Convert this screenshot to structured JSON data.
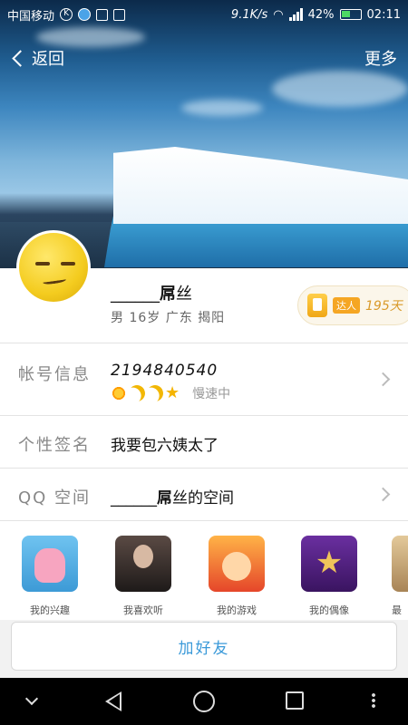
{
  "status_bar": {
    "carrier": "中国移动",
    "net_speed": "9.1K/s",
    "battery": "42%",
    "time": "02:11"
  },
  "nav": {
    "back_label": "返回",
    "more_label": "更多"
  },
  "profile": {
    "nickname_prefix": "______",
    "nickname_bold": "屌",
    "nickname_suffix": "丝",
    "details": "男  16岁  广东  揭阳",
    "badge_tag": "达人",
    "badge_days": "195天"
  },
  "account_row": {
    "label": "帐号信息",
    "qq_number": "2194840540",
    "speed_text": "慢速中",
    "level_icons": [
      "sun",
      "moon",
      "moon",
      "star"
    ]
  },
  "signature_row": {
    "label": "个性签名",
    "value": "我要包六姨太了"
  },
  "zone_row": {
    "label": "QQ 空间",
    "value_prefix": "______",
    "value_bold": "屌",
    "value_suffix": "丝的空间"
  },
  "apps": [
    {
      "label": "我的兴趣",
      "icon": "interest-icon"
    },
    {
      "label": "我喜欢听",
      "icon": "music-icon"
    },
    {
      "label": "我的游戏",
      "icon": "game-icon"
    },
    {
      "label": "我的偶像",
      "icon": "idol-icon"
    },
    {
      "label": "最",
      "icon": "extra-app-icon"
    }
  ],
  "actions": {
    "add_friend_label": "加好友"
  }
}
